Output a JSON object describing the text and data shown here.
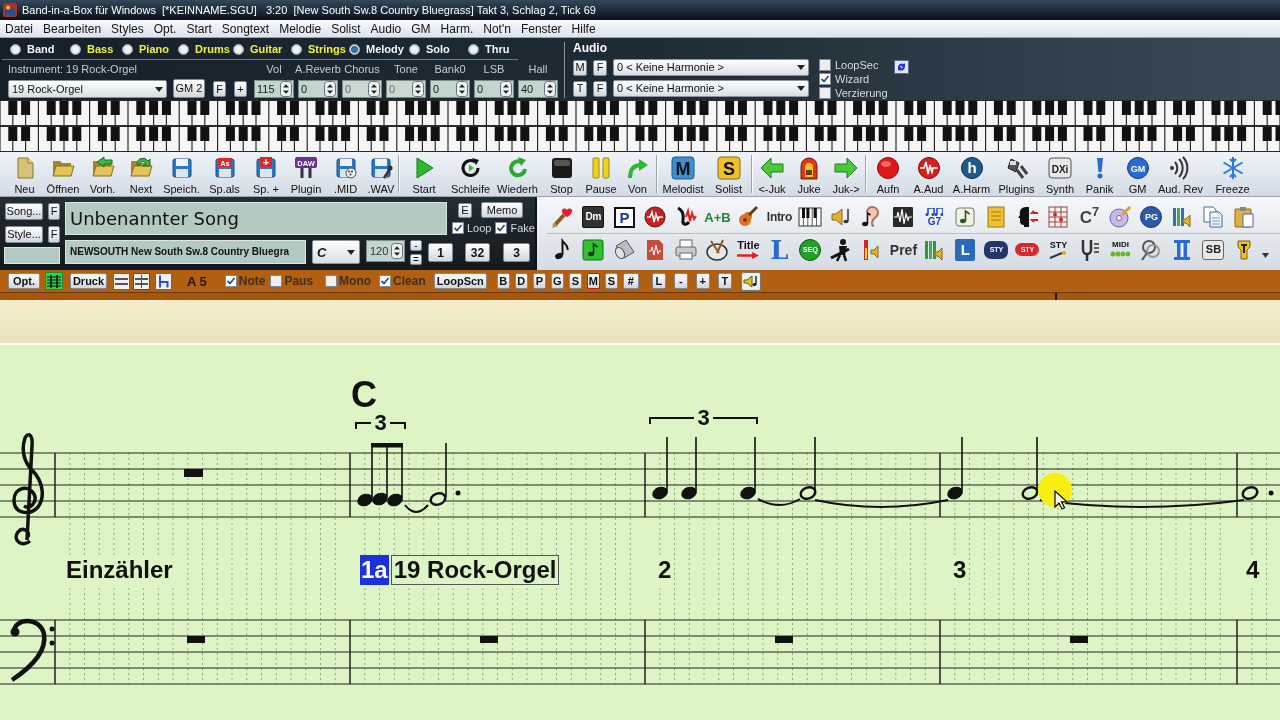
{
  "title_bar": {
    "title": "Band-in-a-Box für Windows  [*KEINNAME.SGU]   3:20  [New South Sw.8 Country Bluegrass] Takt 3, Schlag 2, Tick 69"
  },
  "menu": [
    "Datei",
    "Bearbeiten",
    "Styles",
    "Opt.",
    "Start",
    "Songtext",
    "Melodie",
    "Solist",
    "Audio",
    "GM",
    "Harm.",
    "Not'n",
    "Fenster",
    "Hilfe"
  ],
  "mixer": {
    "tracks": [
      {
        "label": "Band",
        "selected": false,
        "active": false
      },
      {
        "label": "Bass",
        "selected": false,
        "active": true
      },
      {
        "label": "Piano",
        "selected": false,
        "active": true
      },
      {
        "label": "Drums",
        "selected": false,
        "active": true
      },
      {
        "label": "Guitar",
        "selected": false,
        "active": true
      },
      {
        "label": "Strings",
        "selected": false,
        "active": true
      },
      {
        "label": "Melody",
        "selected": true,
        "active": false
      },
      {
        "label": "Solo",
        "selected": false,
        "active": false
      },
      {
        "label": "Thru",
        "selected": false,
        "active": false
      }
    ],
    "instrument_label": "Instrument: 19 Rock-Orgel",
    "instrument": "19 Rock-Orgel",
    "buttons": [
      "GM 2",
      "F",
      "+"
    ],
    "controls": [
      {
        "label": "Vol",
        "value": "115",
        "disabled": false
      },
      {
        "label": "A.Reverb",
        "value": "0",
        "disabled": false
      },
      {
        "label": "Chorus",
        "value": "0",
        "disabled": true
      },
      {
        "label": "Tone",
        "value": "0",
        "disabled": true
      },
      {
        "label": "Bank0",
        "value": "0",
        "disabled": false
      },
      {
        "label": "LSB",
        "value": "0",
        "disabled": false
      },
      {
        "label": "Hall",
        "value": "40",
        "disabled": false
      }
    ]
  },
  "audio": {
    "title": "Audio",
    "rows": [
      {
        "buttons": [
          "M",
          "F"
        ],
        "harmony": "0 < Keine Harmonie >"
      },
      {
        "buttons": [
          "T",
          "F"
        ],
        "harmony": "0 < Keine Harmonie >"
      }
    ],
    "options": [
      {
        "label": "LoopSec",
        "checked": false
      },
      {
        "label": "Wizard",
        "checked": true
      },
      {
        "label": "Verzierung",
        "checked": false
      }
    ]
  },
  "toolbar": [
    [
      {
        "label": "Neu"
      },
      {
        "label": "Öffnen"
      },
      {
        "label": "Vorh."
      },
      {
        "label": "Next"
      },
      {
        "label": "Speich."
      },
      {
        "label": "Sp.als",
        "glyph": "As"
      },
      {
        "label": "Sp. +",
        "glyph": "+"
      },
      {
        "label": "Plugin",
        "glyph": "DAW"
      },
      {
        "label": ".MID"
      },
      {
        "label": ".WAV"
      }
    ],
    [
      {
        "label": "Start"
      },
      {
        "label": "Schleife"
      },
      {
        "label": "Wiederh"
      },
      {
        "label": "Stop"
      },
      {
        "label": "Pause"
      },
      {
        "label": "Von"
      }
    ],
    [
      {
        "label": "Melodist",
        "glyph": "M"
      },
      {
        "label": "Solist",
        "glyph": "S"
      }
    ],
    [
      {
        "label": "<-Juk"
      },
      {
        "label": "Juke"
      },
      {
        "label": "Juk->"
      }
    ],
    [
      {
        "label": "Aufn"
      },
      {
        "label": "A.Aud"
      },
      {
        "label": "A.Harm",
        "glyph": "h"
      },
      {
        "label": "Plugins"
      },
      {
        "label": "Synth",
        "glyph": "DXi"
      },
      {
        "label": "Panik"
      },
      {
        "label": "GM",
        "glyph": "GM"
      },
      {
        "label": "Aud. Rev"
      },
      {
        "label": "Freeze"
      }
    ]
  ],
  "song": {
    "side_buttons": [
      {
        "label": "Song...",
        "flag": "F"
      },
      {
        "label": "Style...",
        "flag": "F"
      }
    ],
    "title": "Unbenannter Song",
    "style": "NEWSOUTH New South Sw.8 Country Bluegra",
    "edit_button": "E",
    "memo_button": "Memo",
    "options": [
      {
        "label": "Loop",
        "checked": true
      },
      {
        "label": "Fake",
        "checked": true
      }
    ],
    "key": "C",
    "tempo": "120",
    "step_buttons": [
      "-",
      "="
    ],
    "counters": [
      "1",
      "32",
      "3"
    ]
  },
  "tool_grid": {
    "row_1": [
      "Dm",
      "P",
      "A+B",
      "Intro",
      "G7",
      "C$^{7}$",
      "PG"
    ],
    "row_2": [
      "Title",
      "L",
      "SEQ",
      "Pref",
      "L",
      "STY",
      "STY",
      "STY",
      "MIDI",
      "SB"
    ]
  },
  "notation_bar": {
    "opt_button": "Opt.",
    "staff_view_on": true,
    "print_button": "Druck",
    "position": "A 5",
    "options": [
      {
        "label": "Note",
        "checked": true
      },
      {
        "label": "Paus",
        "checked": false
      },
      {
        "label": "Mono",
        "checked": false
      },
      {
        "label": "Clean",
        "checked": true
      }
    ],
    "loop_button": "LoopScn",
    "track_buttons": [
      {
        "label": "B",
        "on": false
      },
      {
        "label": "D",
        "on": false
      },
      {
        "label": "P",
        "on": false
      },
      {
        "label": "G",
        "on": false
      },
      {
        "label": "S",
        "on": false
      },
      {
        "label": "M",
        "on": true
      },
      {
        "label": "S",
        "on": false
      },
      {
        "label": "#",
        "on": false
      }
    ],
    "zoom_buttons": [
      "L",
      "-",
      "+",
      "T"
    ]
  },
  "notation": {
    "chord": "C",
    "triplets": [
      "3",
      "3"
    ],
    "bars": [
      {
        "label": "Einzähler",
        "highlighted": false
      },
      {
        "label": "1a",
        "highlighted": true,
        "patch": "19 Rock-Orgel"
      },
      {
        "label": "2",
        "highlighted": false
      },
      {
        "label": "3",
        "highlighted": false
      },
      {
        "label": "4",
        "highlighted": false
      }
    ]
  }
}
